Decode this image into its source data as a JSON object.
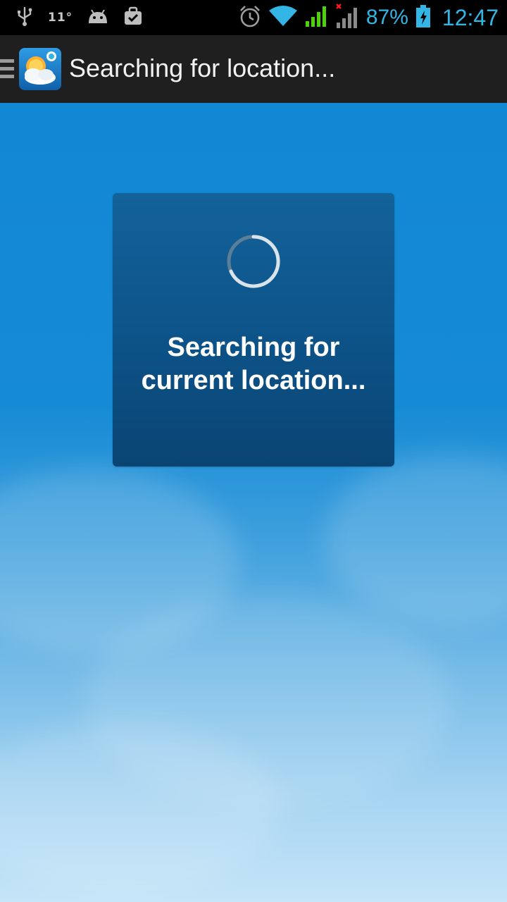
{
  "status_bar": {
    "temperature": "11°",
    "battery_percent": "87%",
    "time": "12:47",
    "icons": [
      "usb-icon",
      "android-icon",
      "briefcase-check-icon",
      "alarm-icon",
      "wifi-icon",
      "signal-icon",
      "signal-no-service-icon",
      "battery-charging-icon"
    ]
  },
  "action_bar": {
    "title": "Searching for location...",
    "icons": [
      "hamburger-menu-icon",
      "weather-app-icon"
    ]
  },
  "loading": {
    "message": "Searching for current location...",
    "icon": "loading-spinner-icon"
  },
  "colors": {
    "status_accent": "#33b5e5",
    "action_bar_bg": "#1f1f1f",
    "sky_top": "#1287d3",
    "sky_bottom": "#c5e5f8",
    "card_top": "#13629a",
    "card_bottom": "#0a4473"
  }
}
